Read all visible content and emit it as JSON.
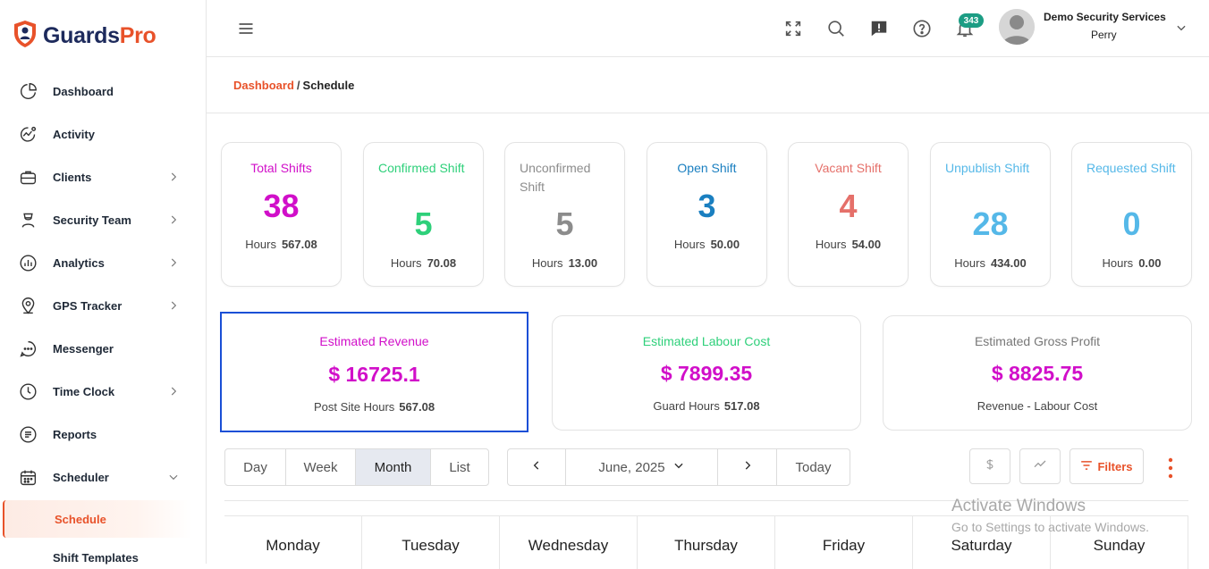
{
  "brand": {
    "name_part1": "Guards",
    "name_part2": "Pro"
  },
  "sidebar": {
    "items": [
      {
        "label": "Dashboard",
        "icon": "pie-chart-icon",
        "has_chevron": false
      },
      {
        "label": "Activity",
        "icon": "activity-icon",
        "has_chevron": false
      },
      {
        "label": "Clients",
        "icon": "briefcase-icon",
        "has_chevron": true
      },
      {
        "label": "Security Team",
        "icon": "team-icon",
        "has_chevron": true
      },
      {
        "label": "Analytics",
        "icon": "analytics-icon",
        "has_chevron": true
      },
      {
        "label": "GPS Tracker",
        "icon": "location-pin-icon",
        "has_chevron": true
      },
      {
        "label": "Messenger",
        "icon": "chat-icon",
        "has_chevron": false
      },
      {
        "label": "Time Clock",
        "icon": "clock-icon",
        "has_chevron": true
      },
      {
        "label": "Reports",
        "icon": "report-icon",
        "has_chevron": false
      },
      {
        "label": "Scheduler",
        "icon": "calendar-icon",
        "has_chevron": true,
        "expanded": true
      }
    ],
    "sub_items": [
      {
        "label": "Schedule",
        "active": true
      },
      {
        "label": "Shift Templates",
        "active": false
      }
    ]
  },
  "topbar": {
    "notification_count": "343",
    "user_company": "Demo Security Services",
    "user_name": "Perry"
  },
  "breadcrumb": {
    "home": "Dashboard",
    "separator": "/",
    "current": "Schedule"
  },
  "stats": [
    {
      "title": "Total Shifts",
      "value": "38",
      "hours_label": "Hours",
      "hours": "567.08",
      "color": "#d10fc9"
    },
    {
      "title": "Confirmed Shift",
      "value": "5",
      "hours_label": "Hours",
      "hours": "70.08",
      "color": "#2ed07a"
    },
    {
      "title": "Unconfirmed Shift",
      "value": "5",
      "hours_label": "Hours",
      "hours": "13.00",
      "color": "#8c8c8c"
    },
    {
      "title": "Open Shift",
      "value": "3",
      "hours_label": "Hours",
      "hours": "50.00",
      "color": "#1a7fc0"
    },
    {
      "title": "Vacant Shift",
      "value": "4",
      "hours_label": "Hours",
      "hours": "54.00",
      "color": "#e5706a"
    },
    {
      "title": "Unpublish Shift",
      "value": "28",
      "hours_label": "Hours",
      "hours": "434.00",
      "color": "#55b8e8"
    },
    {
      "title": "Requested Shift",
      "value": "0",
      "hours_label": "Hours",
      "hours": "0.00",
      "color": "#55b8e8"
    }
  ],
  "estimates": [
    {
      "title": "Estimated Revenue",
      "value": "$ 16725.1",
      "sub_label": "Post Site Hours",
      "sub_value": "567.08",
      "title_color": "#d10fc9"
    },
    {
      "title": "Estimated Labour Cost",
      "value": "$ 7899.35",
      "sub_label": "Guard Hours",
      "sub_value": "517.08",
      "title_color": "#2ed07a"
    },
    {
      "title": "Estimated Gross Profit",
      "value": "$ 8825.75",
      "sub_label": "Revenue - Labour Cost",
      "sub_value": "",
      "title_color": "#777777"
    }
  ],
  "view_tabs": [
    {
      "label": "Day",
      "active": false
    },
    {
      "label": "Week",
      "active": false
    },
    {
      "label": "Month",
      "active": true
    },
    {
      "label": "List",
      "active": false
    }
  ],
  "date_nav": {
    "current_period": "June, 2025",
    "today_label": "Today"
  },
  "toolbar": {
    "filters_label": "Filters",
    "accent": "#e8522a"
  },
  "calendar": {
    "weekdays": [
      "Monday",
      "Tuesday",
      "Wednesday",
      "Thursday",
      "Friday",
      "Saturday",
      "Sunday"
    ]
  },
  "watermark": {
    "line1": "Activate Windows",
    "line2": "Go to Settings to activate Windows."
  }
}
